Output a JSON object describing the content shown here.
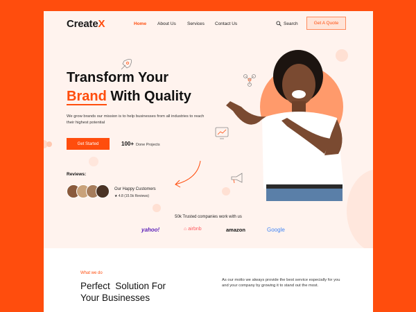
{
  "brand": {
    "name_main": "Create",
    "name_accent": "X",
    "accent_color": "#ff4d0d"
  },
  "nav": {
    "items": [
      {
        "label": "Home",
        "active": true
      },
      {
        "label": "About Us",
        "active": false
      },
      {
        "label": "Services",
        "active": false
      },
      {
        "label": "Contact Us",
        "active": false
      }
    ],
    "search_label": "Search",
    "quote_button": "Get A Quote"
  },
  "hero": {
    "title_line1": "Transform Your",
    "title_brand": "Brand",
    "title_line2_rest": " With Quality",
    "subtitle": "We grow brands our mission is to help businesses  from all industries to reach their highest potential",
    "cta_label": "Get Started",
    "done_count": "100+",
    "done_label": "Done Projects"
  },
  "reviews": {
    "title": "Reviews:",
    "happy_label": "Our Happy Customers",
    "rating_text": "4.8 (15.5k Reviews)"
  },
  "trusted": {
    "title": "50k Trusted companies work with us",
    "logos": [
      "yahoo!",
      "airbnb",
      "amazon",
      "Google"
    ]
  },
  "section2": {
    "eyebrow": "What we do",
    "title_line1": "Perfect  Solution For",
    "title_line2": "Your Businesses",
    "paragraph": "As our motto we always provide the best service  especially for you and your company by growing it to stand out the most."
  }
}
